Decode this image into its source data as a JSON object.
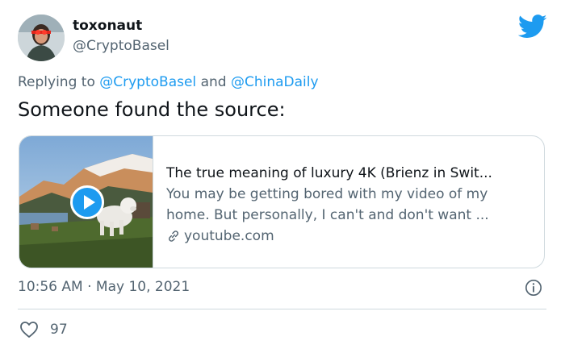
{
  "author": {
    "display_name": "toxonaut",
    "handle": "@CryptoBasel"
  },
  "reply": {
    "prefix": "Replying to",
    "mention1": "@CryptoBasel",
    "conjunction": "and",
    "mention2": "@ChinaDaily"
  },
  "tweet_text": "Someone found the source:",
  "card": {
    "title": "The true meaning of luxury 4K (Brienz in Swit...",
    "description_line1": "You may be getting bored with my video of my",
    "description_line2": "home. But personally, I can't and don't want ...",
    "domain": "youtube.com"
  },
  "meta": {
    "time": "10:56 AM",
    "separator": "·",
    "date": "May 10, 2021"
  },
  "actions": {
    "like_count": "97"
  },
  "colors": {
    "accent": "#1d9bf0",
    "text_primary": "#0f1419",
    "text_secondary": "#536471",
    "border": "#cfd9de"
  },
  "icons": {
    "brand": "twitter-bird-icon",
    "play": "play-icon",
    "link": "link-icon",
    "info": "info-icon",
    "like": "heart-icon"
  }
}
